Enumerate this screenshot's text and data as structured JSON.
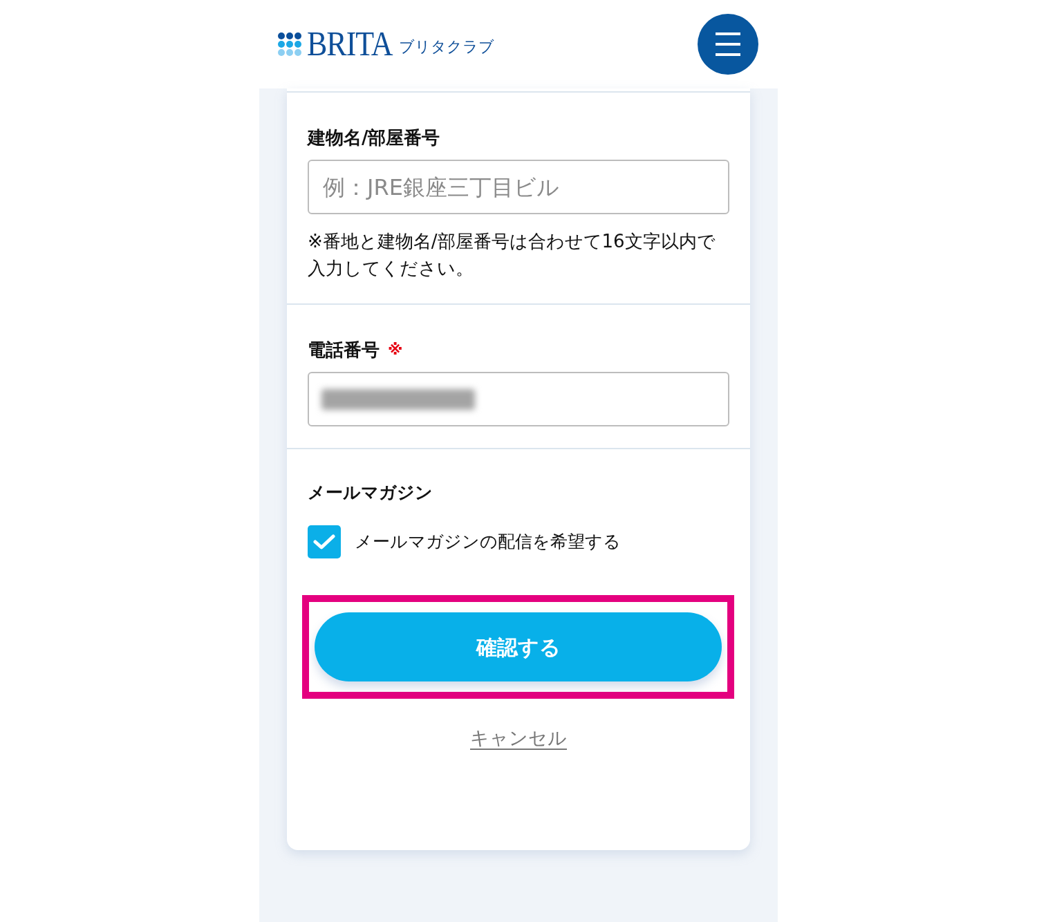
{
  "header": {
    "logo": {
      "brand": "BRITA",
      "tagline": "ブリタクラブ"
    }
  },
  "form": {
    "sections": [
      {
        "kind": "text_field",
        "label": "建物名/部屋番号",
        "required": false,
        "placeholder": "例：JRE銀座三丁目ビル",
        "note": "※番地と建物名/部屋番号は合わせて16文字以内で入力してください。"
      },
      {
        "kind": "text_field",
        "label": "電話番号",
        "required": true,
        "required_mark": "※",
        "value_redacted": true
      },
      {
        "kind": "checkbox",
        "label": "メールマガジン",
        "option": {
          "label": "メールマガジンの配信を希望する",
          "checked": true
        }
      }
    ],
    "submit": {
      "label": "確認する",
      "highlighted": true
    },
    "cancel": {
      "label": "キャンセル"
    }
  }
}
